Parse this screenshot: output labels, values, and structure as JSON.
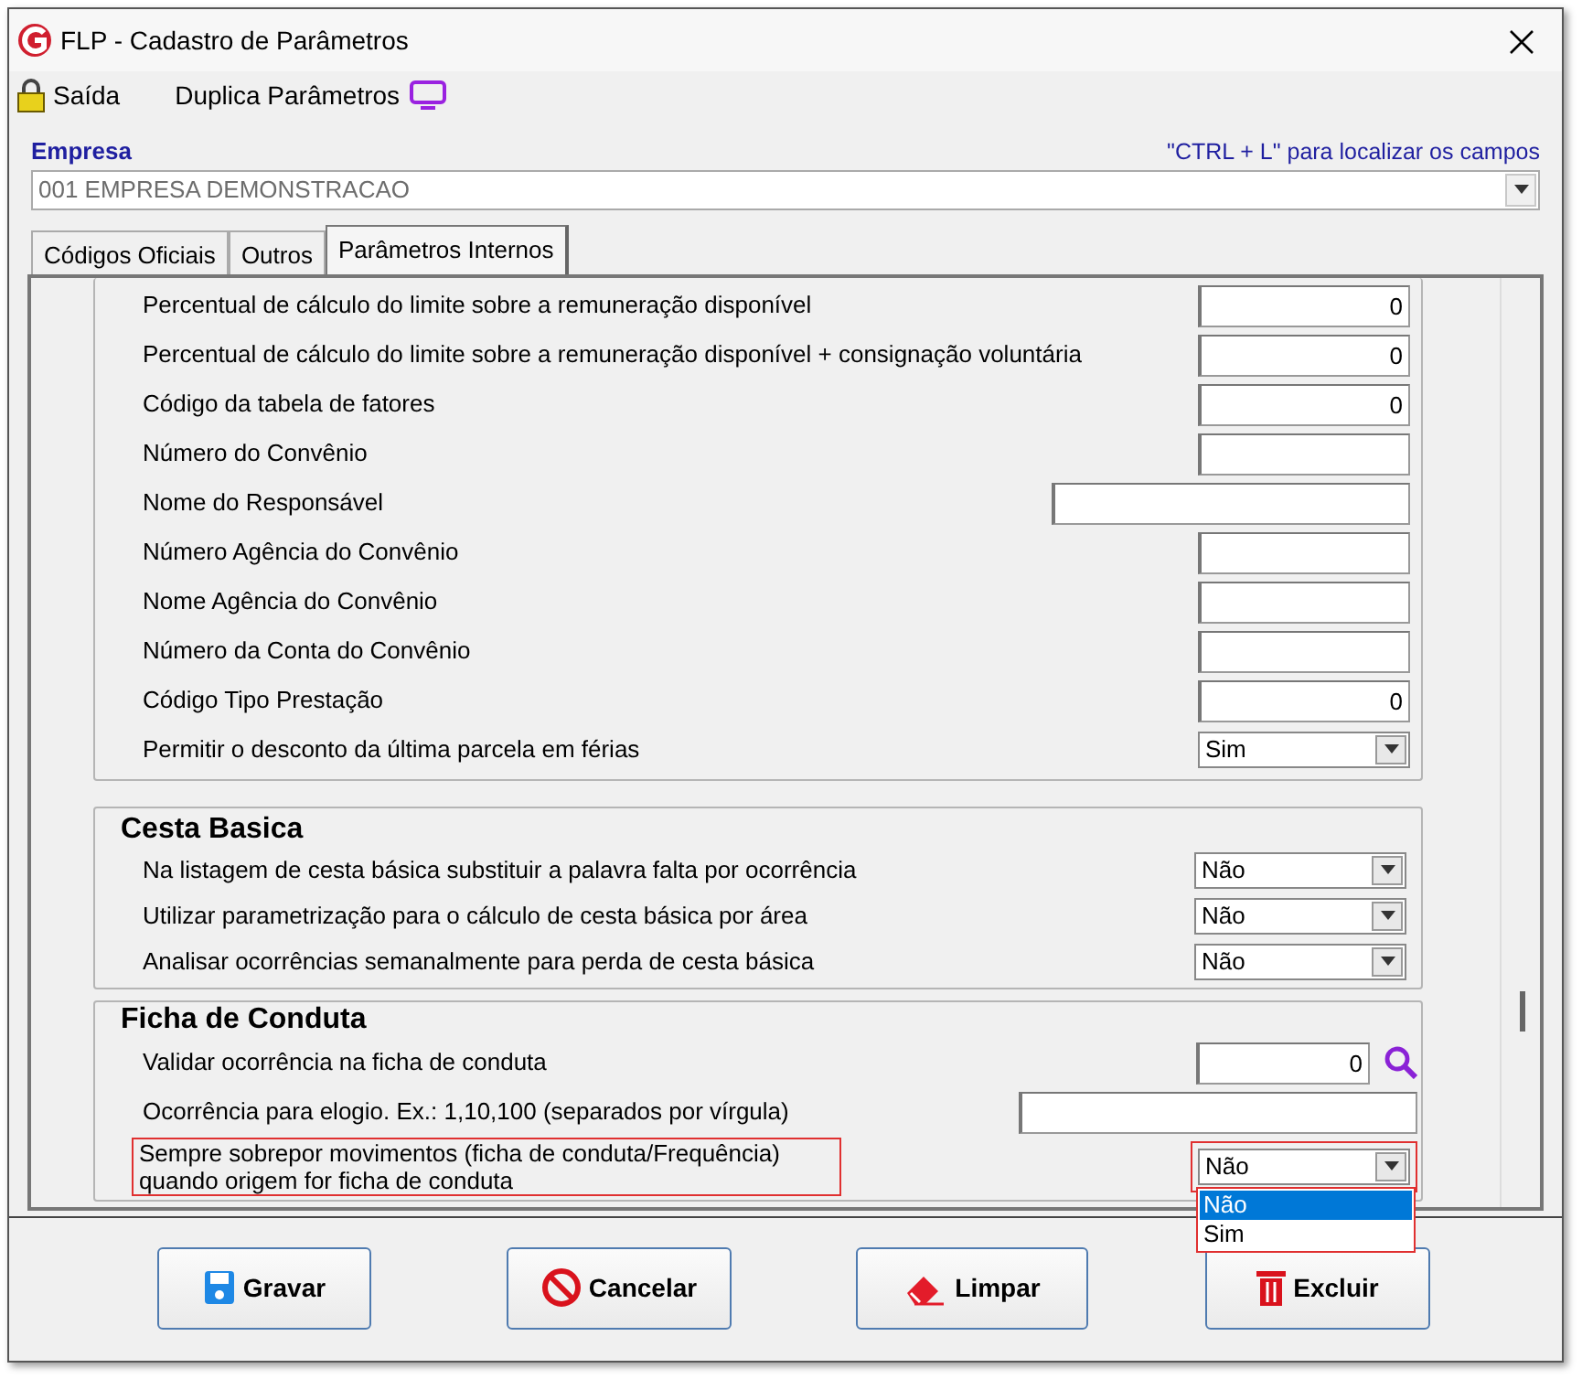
{
  "window": {
    "title": "FLP - Cadastro de Parâmetros"
  },
  "toolbar": [
    {
      "label": "Saída",
      "kind": "lock"
    },
    {
      "label": "Duplica Parâmetros",
      "kind": "monitor"
    }
  ],
  "empresa": {
    "label": "Empresa",
    "hint": "\"CTRL + L\" para localizar os campos",
    "value": "001 EMPRESA DEMONSTRACAO"
  },
  "tabs": [
    {
      "label": "Códigos Oficiais",
      "selected": false
    },
    {
      "label": "Outros",
      "selected": false
    },
    {
      "label": "Parâmetros Internos",
      "selected": true
    }
  ],
  "sections": [
    {
      "fields": [
        {
          "label": "Percentual de cálculo do limite sobre a remuneração disponível",
          "kind": "number",
          "value": "0"
        },
        {
          "label": "Percentual de cálculo do limite sobre a remuneração disponível + consignação voluntária",
          "kind": "number",
          "value": "0"
        },
        {
          "label": "Código da tabela de fatores",
          "kind": "number",
          "value": "0"
        },
        {
          "label": "Número do Convênio",
          "kind": "number"
        },
        {
          "label": "Nome do Responsável",
          "kind": "wide"
        },
        {
          "label": "Número Agência do Convênio",
          "kind": "number"
        },
        {
          "label": "Nome Agência do Convênio",
          "kind": "number"
        },
        {
          "label": "Número da Conta do Convênio",
          "kind": "number"
        },
        {
          "label": "Código Tipo Prestação",
          "kind": "number",
          "value": "0"
        },
        {
          "label": "Permitir o desconto da última parcela em férias",
          "kind": "select",
          "value": "Sim"
        }
      ]
    },
    {
      "title": "Cesta Basica",
      "fields": [
        {
          "label": "Na listagem de cesta básica substituir a palavra falta por ocorrência",
          "kind": "select",
          "value": "Não"
        },
        {
          "label": "Utilizar parametrização para o cálculo de cesta básica por área",
          "kind": "select",
          "value": "Não"
        },
        {
          "label": "Analisar ocorrências semanalmente para  perda de cesta básica",
          "kind": "select",
          "value": "Não"
        }
      ]
    },
    {
      "title": "Ficha de Conduta",
      "fields": [
        {
          "label": "Validar ocorrência na ficha de conduta",
          "kind": "lookup",
          "value": "0"
        },
        {
          "label": "Ocorrência para elogio. Ex.: 1,10,100 (separados por vírgula)",
          "kind": "long"
        },
        {
          "label": "Sempre sobrepor movimentos (ficha de conduta/Frequência)\nquando origem for ficha de conduta",
          "kind": "select",
          "value": "Não",
          "highlighted": true,
          "expanded": true,
          "options": [
            {
              "label": "Não",
              "selected": true
            },
            {
              "label": "Sim",
              "selected": false
            }
          ]
        }
      ]
    }
  ],
  "buttons": [
    {
      "label": "Gravar",
      "kind": "save"
    },
    {
      "label": "Cancelar",
      "kind": "cancel"
    },
    {
      "label": "Limpar",
      "kind": "eraser"
    },
    {
      "label": "Excluir",
      "kind": "trash"
    }
  ]
}
